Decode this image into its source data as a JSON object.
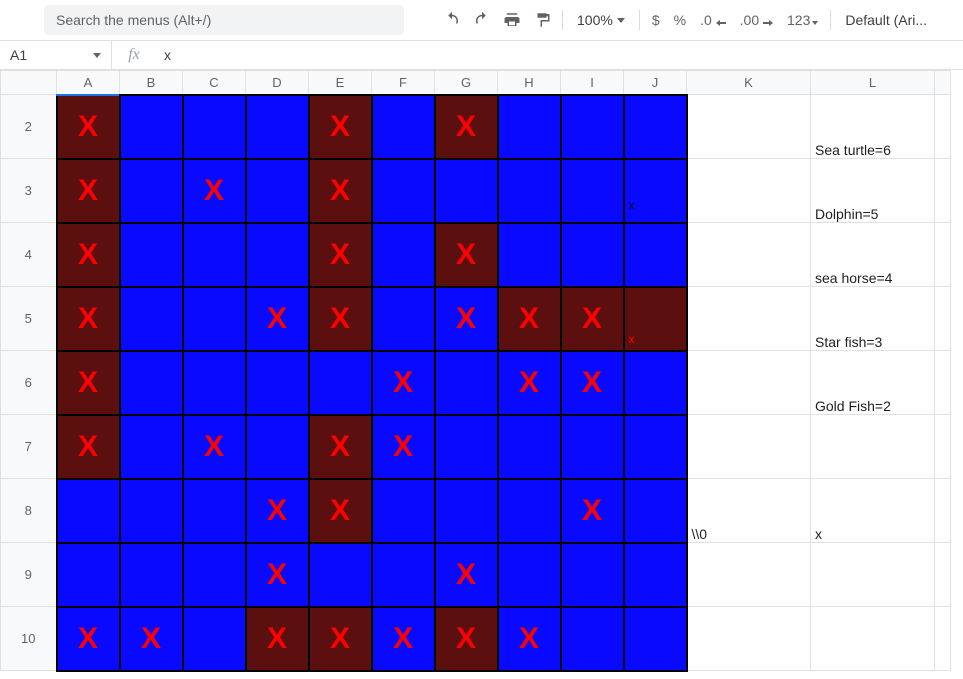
{
  "toolbar": {
    "search_placeholder": "Search the menus (Alt+/)",
    "zoom": "100%",
    "currency": "$",
    "percent": "%",
    "dec_dec": ".0",
    "inc_dec": ".00",
    "format_123": "123",
    "font": "Default (Ari..."
  },
  "namebox": {
    "ref": "A1"
  },
  "formula": {
    "fx": "fx",
    "value": "x"
  },
  "columns": [
    "A",
    "B",
    "C",
    "D",
    "E",
    "F",
    "G",
    "H",
    "I",
    "J",
    "K",
    "L",
    ""
  ],
  "rows": [
    "2",
    "3",
    "4",
    "5",
    "6",
    "7",
    "8",
    "9",
    "10"
  ],
  "grid": {
    "cellClass": [
      [
        "dark x",
        "blue",
        "blue",
        "blue",
        "dark x",
        "blue",
        "dark x",
        "blue",
        "blue",
        "blue"
      ],
      [
        "dark x",
        "blue",
        "blue x",
        "blue",
        "dark x",
        "blue",
        "blue",
        "blue",
        "blue",
        "blue jxd"
      ],
      [
        "dark x",
        "blue",
        "blue",
        "blue",
        "dark x",
        "blue",
        "dark x",
        "blue",
        "blue",
        "blue"
      ],
      [
        "dark x",
        "blue",
        "blue",
        "blue x",
        "dark x",
        "blue",
        "blue x",
        "dark x",
        "dark x",
        "dark jxr"
      ],
      [
        "dark x",
        "blue",
        "blue",
        "blue",
        "blue",
        "blue x",
        "blue",
        "blue x",
        "blue x",
        "blue"
      ],
      [
        "dark x",
        "blue",
        "blue x",
        "blue",
        "dark x",
        "blue x",
        "blue",
        "blue",
        "blue",
        "blue"
      ],
      [
        "blue",
        "blue",
        "blue",
        "blue x",
        "dark x",
        "blue",
        "blue",
        "blue",
        "blue x",
        "blue"
      ],
      [
        "blue",
        "blue",
        "blue",
        "blue x",
        "blue",
        "blue",
        "blue x",
        "blue",
        "blue",
        "blue"
      ],
      [
        "blue x",
        "blue x",
        "blue",
        "dark x",
        "dark x",
        "blue x",
        "dark x",
        "blue x",
        "blue",
        "blue"
      ]
    ],
    "K": [
      "",
      "",
      "",
      "",
      "",
      "",
      "\\\\0",
      "",
      ""
    ],
    "L": [
      "Sea turtle=6",
      "Dolphin=5",
      "sea horse=4",
      "Star fish=3",
      "Gold Fish=2",
      "",
      "x",
      "",
      ""
    ]
  },
  "x_glyph": "X",
  "x_lower": "x"
}
